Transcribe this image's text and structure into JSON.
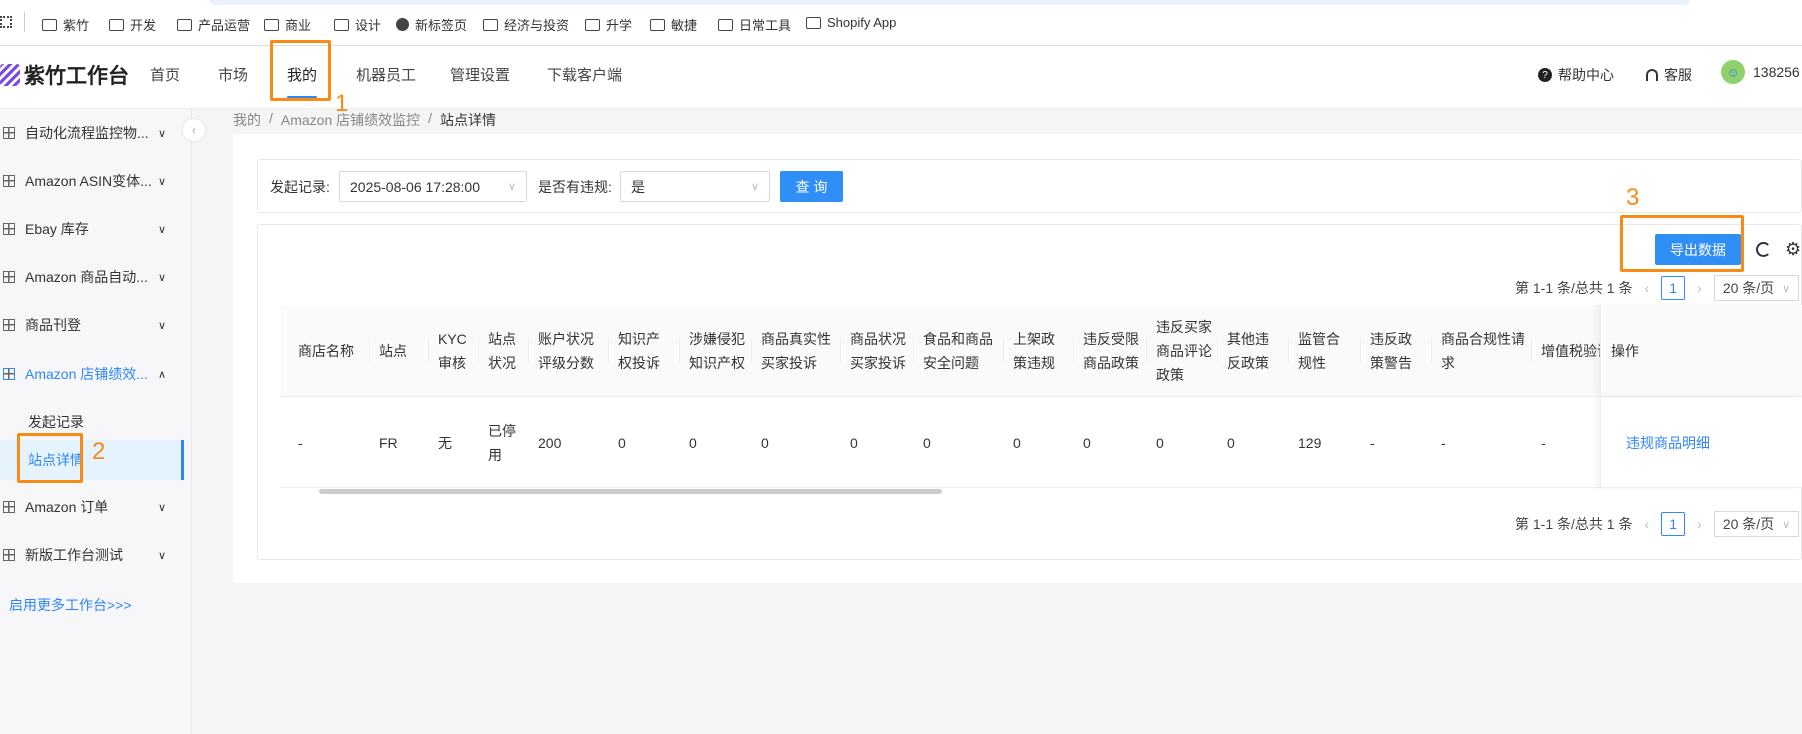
{
  "bookmarks": [
    "紫竹",
    "开发",
    "产品运营",
    "商业",
    "设计",
    "新标签页",
    "经济与投资",
    "升学",
    "敏捷",
    "日常工具",
    "Shopify App"
  ],
  "header": {
    "logo": "紫竹工作台",
    "nav": [
      "首页",
      "市场",
      "我的",
      "机器员工",
      "管理设置",
      "下载客户端"
    ],
    "help": "帮助中心",
    "service": "客服",
    "user": "138256"
  },
  "sidebar": {
    "items": [
      "自动化流程监控物...",
      "Amazon ASIN变体...",
      "Ebay 库存",
      "Amazon 商品自动...",
      "商品刊登",
      "Amazon 店铺绩效..."
    ],
    "sub": [
      "发起记录",
      "站点详情"
    ],
    "items2": [
      "Amazon 订单",
      "新版工作台测试"
    ],
    "more": "启用更多工作台>>>"
  },
  "breadcrumb": [
    "我的",
    "Amazon 店铺绩效监控",
    "站点详情"
  ],
  "filter": {
    "record_label": "发起记录:",
    "record_value": "2025-08-06 17:28:00",
    "violation_label": "是否有违规:",
    "violation_value": "是",
    "query": "查 询"
  },
  "toolbar": {
    "export": "导出数据"
  },
  "pagination": {
    "summary": "第 1-1 条/总共 1 条",
    "page": "1",
    "size": "20 条/页"
  },
  "annotations": [
    "1",
    "2",
    "3"
  ],
  "table": {
    "headers": [
      [
        "商店名称"
      ],
      [
        "站点"
      ],
      [
        "KYC",
        "审核"
      ],
      [
        "站点",
        "状况"
      ],
      [
        "账户状况",
        "评级分数"
      ],
      [
        "知识产",
        "权投诉"
      ],
      [
        "涉嫌侵犯",
        "知识产权"
      ],
      [
        "商品真实性",
        "买家投诉"
      ],
      [
        "商品状况",
        "买家投诉"
      ],
      [
        "食品和商品",
        "安全问题"
      ],
      [
        "上架政",
        "策违规"
      ],
      [
        "违反受限",
        "商品政策"
      ],
      [
        "违反买家",
        "商品评论",
        "政策"
      ],
      [
        "其他违",
        "反政策"
      ],
      [
        "监管合",
        "规性"
      ],
      [
        "违反政",
        "策警告"
      ],
      [
        "商品合规性请",
        "求"
      ],
      [
        "增值税验证"
      ]
    ],
    "action_header": "操作",
    "row": [
      [
        "-"
      ],
      [
        "FR"
      ],
      [
        "无"
      ],
      [
        "已停",
        "用"
      ],
      [
        "200"
      ],
      [
        "0"
      ],
      [
        "0"
      ],
      [
        "0"
      ],
      [
        "0"
      ],
      [
        "0"
      ],
      [
        "0"
      ],
      [
        "0"
      ],
      [
        "0"
      ],
      [
        "0"
      ],
      [
        "129"
      ],
      [
        "-"
      ],
      [
        "-"
      ],
      [
        "-"
      ]
    ],
    "action": "违规商品明细"
  },
  "colors": {
    "accent": "#2f86f6",
    "annotation": "#f78b14"
  }
}
